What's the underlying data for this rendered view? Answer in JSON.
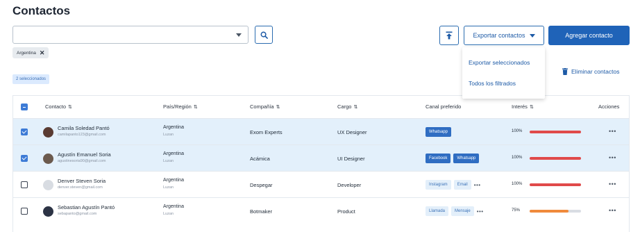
{
  "page": {
    "title": "Contactos"
  },
  "search": {
    "value": "",
    "placeholder": ""
  },
  "filter_chip": {
    "label": "Argentina"
  },
  "toolbar": {
    "export_label": "Exportar contactos",
    "add_label": "Agregar contacto",
    "delete_label": "Eliminar contactos"
  },
  "export_menu": {
    "options": [
      "Exportar seleccionados",
      "Todos los filtrados"
    ]
  },
  "selection": {
    "count_label": "2 seleccionados"
  },
  "table": {
    "headers": {
      "contact": "Contacto",
      "country": "País/Región",
      "company": "Compañía",
      "role": "Cargo",
      "channel": "Canal preferido",
      "interest": "Interés",
      "actions": "Acciones"
    },
    "rows": [
      {
        "selected": true,
        "name": "Camila Soledad Pantó",
        "email": "camilapanto123@gmail.com",
        "country": "Argentina",
        "city": "Luzan",
        "company": "Exom Experts",
        "role": "UX Designer",
        "channels": [
          {
            "label": "Whatsapp",
            "style": "solid"
          }
        ],
        "more_channels": false,
        "interest_label": "100%",
        "interest_value": 100,
        "interest_color": "#e04a4a",
        "avatar_color": "#5a3b32",
        "more": "•••"
      },
      {
        "selected": true,
        "name": "Agustín Emanuel Soria",
        "email": "agustinesoria90@gmail.com",
        "country": "Argentina",
        "city": "Luzan",
        "company": "Acámica",
        "role": "UI Designer",
        "channels": [
          {
            "label": "Facebook",
            "style": "solid"
          },
          {
            "label": "Whatsapp",
            "style": "solid"
          }
        ],
        "more_channels": false,
        "interest_label": "100%",
        "interest_value": 100,
        "interest_color": "#e04a4a",
        "avatar_color": "#6b5a4e",
        "more": "•••"
      },
      {
        "selected": false,
        "name": "Denver Steven Soria",
        "email": "denver.steven@gmail.com",
        "country": "Argentina",
        "city": "Luzan",
        "company": "Despegar",
        "role": "Developer",
        "channels": [
          {
            "label": "Instagram",
            "style": "light"
          },
          {
            "label": "Email",
            "style": "light"
          }
        ],
        "more_channels": true,
        "interest_label": "100%",
        "interest_value": 100,
        "interest_color": "#e04a4a",
        "avatar_color": "#d8dce2",
        "more": "•••"
      },
      {
        "selected": false,
        "name": "Sebastian Agustín Pantó",
        "email": "sebapanto@gmail.com",
        "country": "Argentina",
        "city": "Luzan",
        "company": "Botmaker",
        "role": "Product",
        "channels": [
          {
            "label": "Llamada",
            "style": "light"
          },
          {
            "label": "Mensaje",
            "style": "light"
          }
        ],
        "more_channels": true,
        "interest_label": "75%",
        "interest_value": 75,
        "interest_color": "#f08a3c",
        "avatar_color": "#2c3345",
        "more": "•••"
      }
    ]
  },
  "colors": {
    "primary": "#1f63b8",
    "selected_row": "#e3f0fb",
    "interest_high": "#e04a4a",
    "interest_mid": "#f08a3c"
  }
}
